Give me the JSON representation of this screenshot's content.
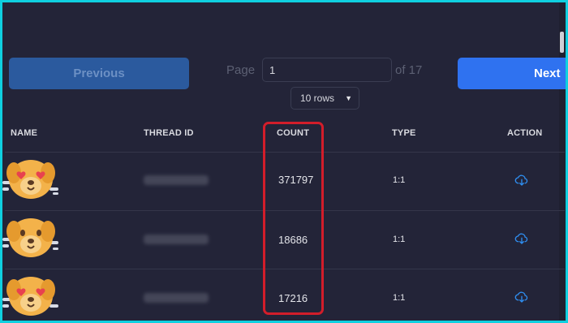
{
  "pagination": {
    "previous_label": "Previous",
    "next_label": "Next",
    "page_label": "Page",
    "page_value": "1",
    "of_label": "of 17",
    "rows_option": "10 rows"
  },
  "table": {
    "headers": [
      "NAME",
      "THREAD ID",
      "COUNT",
      "TYPE",
      "ACTION"
    ],
    "rows": [
      {
        "count": "371797",
        "type": "1:1",
        "action_icon": "cloud-download-icon"
      },
      {
        "count": "18686",
        "type": "1:1",
        "action_icon": "cloud-download-icon"
      },
      {
        "count": "17216",
        "type": "1:1",
        "action_icon": "cloud-download-icon"
      }
    ]
  },
  "colors": {
    "accent_blue": "#2f72f0",
    "disabled_blue": "#2b5a9e",
    "highlight_red": "#d21d2a",
    "frame_cyan": "#0fd0e0",
    "background": "#232438"
  }
}
